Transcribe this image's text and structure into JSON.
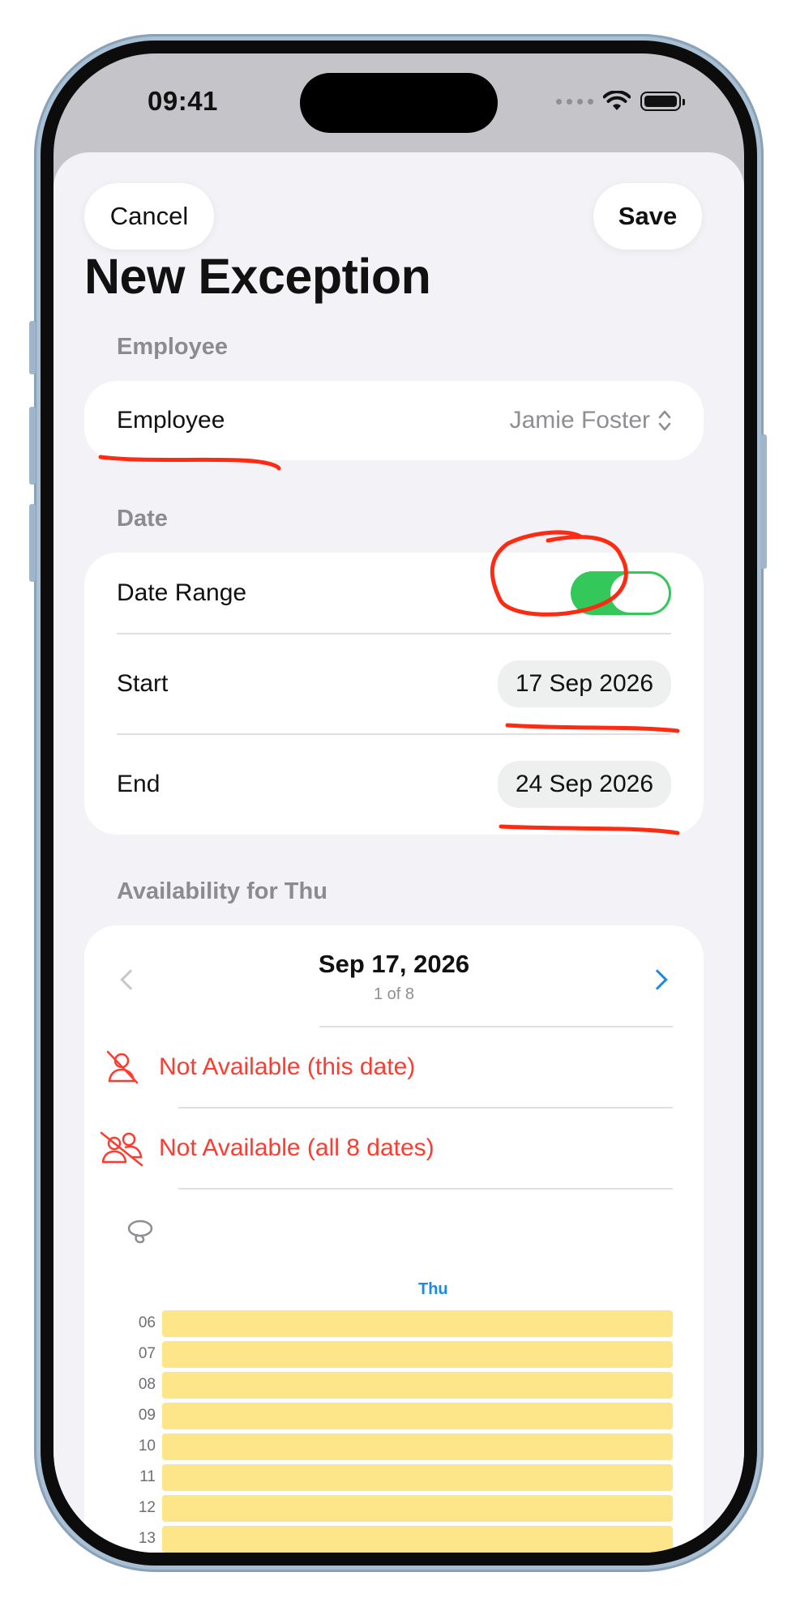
{
  "status_bar": {
    "time": "09:41"
  },
  "nav": {
    "cancel_label": "Cancel",
    "save_label": "Save",
    "title": "New Exception"
  },
  "employee_section": {
    "header": "Employee",
    "row_label": "Employee",
    "selected_value": "Jamie Foster"
  },
  "date_section": {
    "header": "Date",
    "range_label": "Date Range",
    "range_enabled": true,
    "start_label": "Start",
    "start_value": "17 Sep 2026",
    "end_label": "End",
    "end_value": "24 Sep 2026"
  },
  "availability_section": {
    "header": "Availability for Thu",
    "date_title": "Sep 17, 2026",
    "date_position": "1 of 8",
    "not_available_this": "Not Available (this date)",
    "not_available_all": "Not Available (all 8 dates)",
    "day_column": "Thu",
    "hours": [
      "06",
      "07",
      "08",
      "09",
      "10",
      "11",
      "12",
      "13"
    ]
  },
  "colors": {
    "accent_blue": "#1e88e5",
    "toggle_green": "#34c759",
    "destructive_red": "#ff3b30",
    "slot_yellow": "#fde68a",
    "annotation_red": "#ff2a12"
  }
}
